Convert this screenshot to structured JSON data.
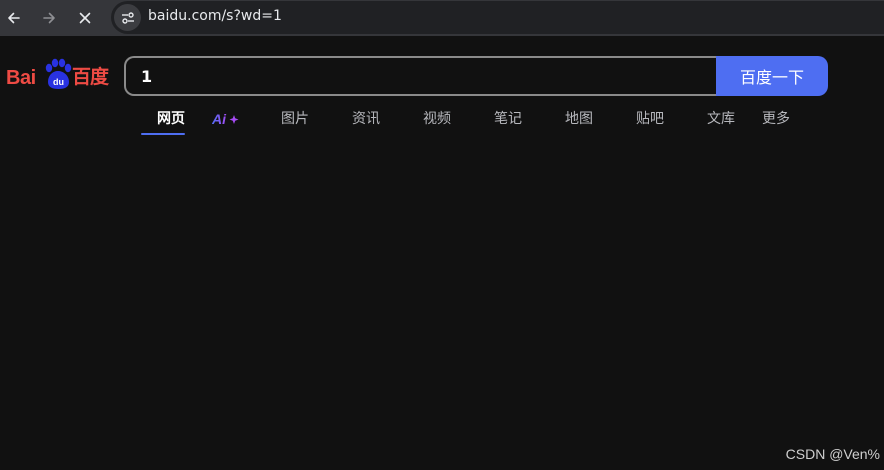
{
  "browser": {
    "url": "baidu.com/s?wd=1",
    "icons": {
      "back": "arrow-left-icon",
      "forward": "arrow-right-icon",
      "stop": "close-icon",
      "site_info": "tune-icon"
    }
  },
  "logo": {
    "latin_text": "Bai",
    "chinese_text": "百度",
    "paw_letters": "du",
    "colors": {
      "text": "#ee4b44",
      "paw": "#2932e1"
    }
  },
  "search": {
    "query": "1",
    "button_label": "百度一下",
    "button_color": "#4e6ef2"
  },
  "tabs": [
    {
      "label": "网页",
      "active": true
    },
    {
      "label": "Ai",
      "icon": "ai-sparkle-icon"
    },
    {
      "label": "图片"
    },
    {
      "label": "资讯"
    },
    {
      "label": "视频"
    },
    {
      "label": "笔记"
    },
    {
      "label": "地图"
    },
    {
      "label": "贴吧"
    },
    {
      "label": "文库"
    },
    {
      "label": "更多"
    }
  ],
  "watermark": "CSDN @Ven%"
}
